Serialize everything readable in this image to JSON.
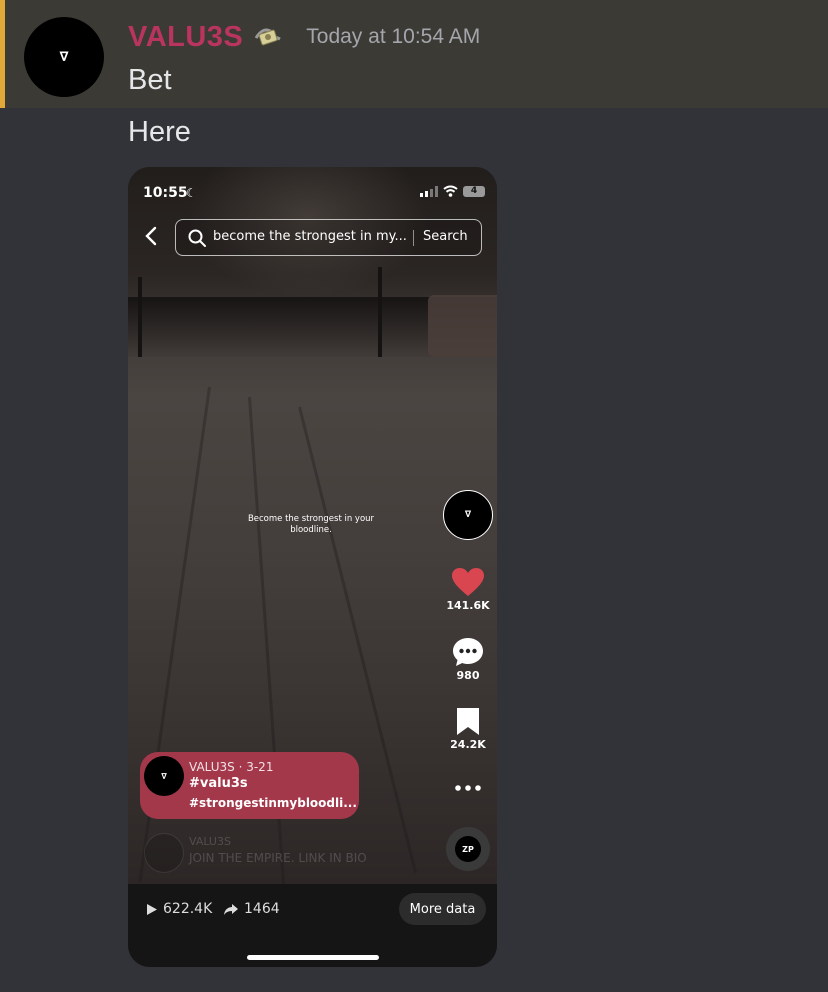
{
  "message": {
    "username": "VALU3S",
    "role_icon": "money-with-wings",
    "timestamp": "Today at 10:54 AM",
    "lines": [
      "Bet",
      "Here"
    ],
    "avatar_logo": "∇",
    "colors": {
      "username": "#b9345f",
      "highlight_bar": "#e0a93a",
      "background": "#313338"
    }
  },
  "phone": {
    "status_time": "10:55",
    "battery": "4",
    "search_query": "become the strongest in my...",
    "search_button": "Search",
    "caption": "Become the strongest in your bloodline.",
    "side": {
      "profile_logo": "∇",
      "likes": "141.6K",
      "comments": "980",
      "saves": "24.2K"
    },
    "pill": {
      "avatar_logo": "∇",
      "meta": "VALU3S · 3-21",
      "tag1": "#valu3s",
      "tag2": "#strongestinmybloodli..."
    },
    "faded": {
      "name": "VALU3S",
      "bio": "JOIN THE EMPIRE. LINK IN BIO"
    },
    "zp_logo": "ZP",
    "bottom": {
      "plays": "622.4K",
      "shares": "1464",
      "more_button": "More data"
    }
  }
}
